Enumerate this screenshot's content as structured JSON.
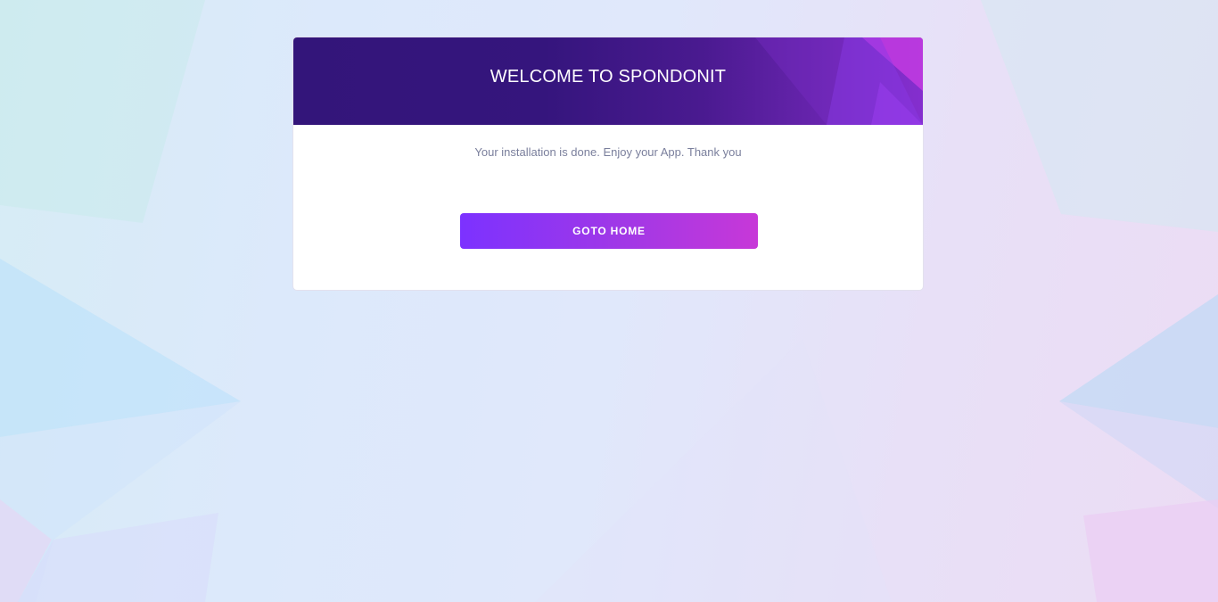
{
  "card": {
    "title": "WELCOME TO SPONDONIT",
    "message": "Your installation is done. Enjoy your App. Thank you",
    "button_label": "GOTO HOME"
  },
  "colors": {
    "header_dark": "#33157a",
    "header_accent": "#c738d8",
    "button_start": "#7c32ff",
    "button_end": "#c738d8",
    "message_text": "#7a7f9c"
  }
}
